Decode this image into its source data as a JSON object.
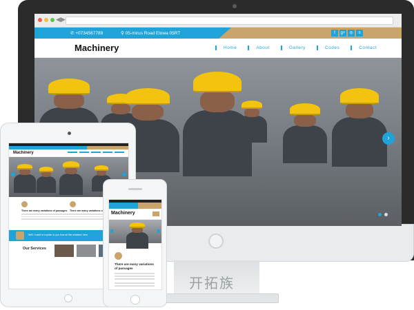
{
  "site": {
    "phone": "+0734567789",
    "address": "05-mirus Road Elowa 05RT",
    "logo": "Machinery",
    "menu": [
      "Home",
      "About",
      "Gallery",
      "Codes",
      "Contact"
    ],
    "social_icons": [
      "facebook-icon",
      "google-plus-icon",
      "instagram-icon",
      "share-icon"
    ],
    "social_glyphs": [
      "f",
      "g+",
      "◎",
      "≡"
    ],
    "hero_next": "›"
  },
  "tablet": {
    "feature_title": "There are many variations of passages",
    "banner_text": "Well I made to explain to you how all this mistaken idea",
    "services_title": "Our Services"
  },
  "phone_view": {
    "feature_title": "There are many variations of passages"
  },
  "watermark": "开拓族",
  "colors": {
    "accent_blue": "#1fa3d8",
    "accent_tan": "#c9a46b",
    "hard_hat": "#f2c30f"
  }
}
